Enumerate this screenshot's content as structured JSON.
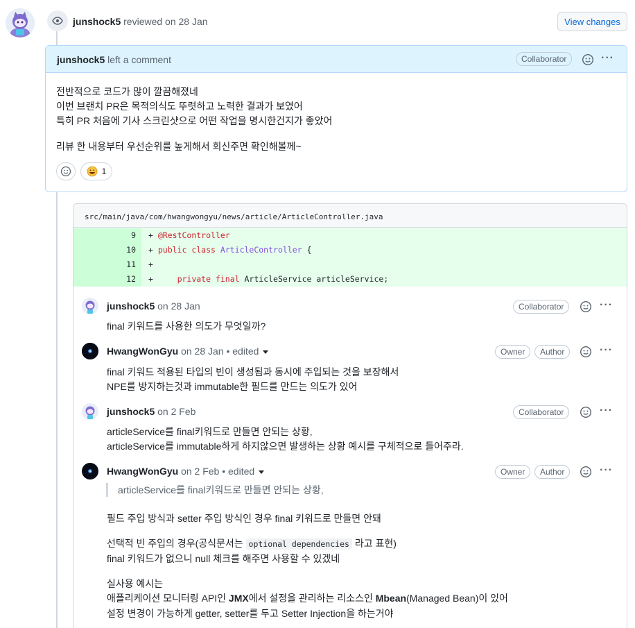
{
  "review": {
    "reviewer": "junshock5",
    "action": "reviewed on 28 Jan",
    "view_changes": "View changes"
  },
  "top_comment": {
    "author": "junshock5",
    "action": "left a comment",
    "badge": "Collaborator",
    "lines": [
      "전반적으로 코드가 많이 깔끔해졌네",
      "이번 브랜치 PR은 목적의식도 뚜렷하고 노력한 결과가 보였어",
      "특히 PR 처음에 기사 스크린샷으로 어떤 작업을 명시한건지가 좋았어",
      "리뷰 한 내용부터 우선순위를 높게해서 회신주면 확인해볼께~"
    ],
    "reaction_count": "1",
    "reaction_icon": "grinning-face-icon"
  },
  "thread": {
    "file_path": "src/main/java/com/hwangwongyu/news/article/ArticleController.java",
    "diff": [
      {
        "num": "9",
        "prefix": "+ ",
        "code": "@RestController"
      },
      {
        "num": "10",
        "prefix": "+ ",
        "code": "public class ArticleController {"
      },
      {
        "num": "11",
        "prefix": "+ ",
        "code": ""
      },
      {
        "num": "12",
        "prefix": "+ ",
        "code": "    private final ArticleService articleService;"
      }
    ],
    "comments": [
      {
        "author": "junshock5",
        "meta": "on 28 Jan",
        "badges": [
          "Collaborator"
        ],
        "lines": [
          "final 키워드를 사용한 의도가 무엇일까?"
        ]
      },
      {
        "author": "HwangWonGyu",
        "meta": "on 28 Jan • edited",
        "badges": [
          "Owner",
          "Author"
        ],
        "lines": [
          "final 키워드 적용된 타입의 빈이 생성됨과 동시에 주입되는 것을 보장해서",
          "NPE를 방지하는것과 immutable한 필드를 만드는 의도가 있어"
        ]
      },
      {
        "author": "junshock5",
        "meta": "on 2 Feb",
        "badges": [
          "Collaborator"
        ],
        "lines": [
          "articleService를 final키워드로 만들면 안되는 상황,",
          "articleService를 immutable하게 하지않으면 발생하는 상황 예시를 구체적으로 들어주라."
        ]
      },
      {
        "author": "HwangWonGyu",
        "meta": "on 2 Feb • edited",
        "badges": [
          "Owner",
          "Author"
        ],
        "quote": "articleService를 final키워드로 만들면 안되는 상황,",
        "p1": "필드 주입 방식과 setter 주입 방식인 경우 final 키워드로 만들면 안돼",
        "p2a_pre": "선택적 빈 주입의 경우(공식문서는 ",
        "p2a_code": "optional dependencies",
        "p2a_post": " 라고 표현)",
        "p2b": "final 키워드가 없으니 null 체크를 해주면 사용할 수 있겠네",
        "p3a": "실사용 예시는",
        "p3b_pre": "애플리케이션 모니터링 API인 ",
        "p3b_jmx": "JMX",
        "p3b_mid": "에서 설정을 관리하는 리소스인 ",
        "p3b_mbean": "Mbean",
        "p3b_post": "(Managed Bean)이 있어",
        "p3c": "설정 변경이 가능하게 getter, setter를 두고 Setter Injection을 하는거야"
      }
    ]
  },
  "colors": {
    "accent": "#0969da",
    "header_bg": "#ddf4ff",
    "diff_add": "#e6ffec"
  }
}
